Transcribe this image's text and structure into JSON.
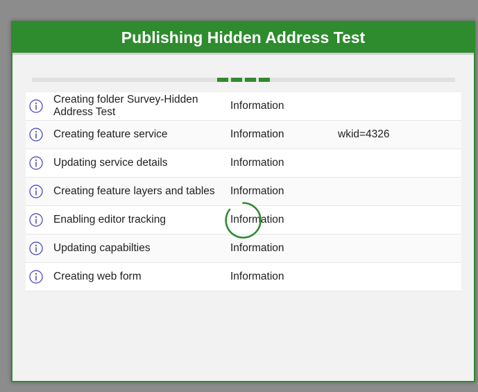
{
  "dialog": {
    "title": "Publishing Hidden Address Test",
    "accent_color": "#2e8b2e",
    "progress_indicator": "indeterminate",
    "loading_spinner": "loading-spinner-icon"
  },
  "log": {
    "rows": [
      {
        "icon": "info-icon",
        "message": "Creating folder Survey-Hidden Address Test",
        "type": "Information",
        "detail": ""
      },
      {
        "icon": "info-icon",
        "message": "Creating feature service",
        "type": "Information",
        "detail": "wkid=4326"
      },
      {
        "icon": "info-icon",
        "message": "Updating service details",
        "type": "Information",
        "detail": ""
      },
      {
        "icon": "info-icon",
        "message": "Creating feature layers and tables",
        "type": "Information",
        "detail": ""
      },
      {
        "icon": "info-icon",
        "message": "Enabling editor tracking",
        "type": "Information",
        "detail": ""
      },
      {
        "icon": "info-icon",
        "message": "Updating capabilties",
        "type": "Information",
        "detail": ""
      },
      {
        "icon": "info-icon",
        "message": "Creating web form",
        "type": "Information",
        "detail": ""
      }
    ]
  }
}
